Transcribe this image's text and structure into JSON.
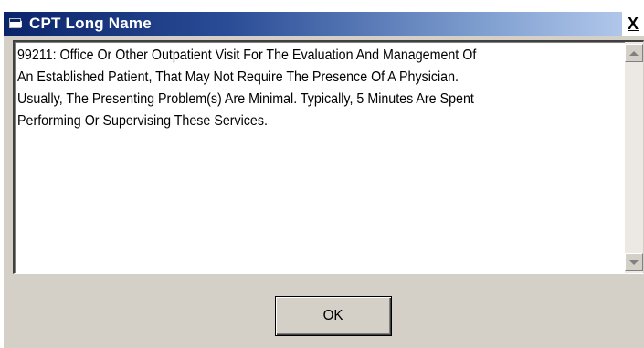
{
  "window": {
    "title": "CPT Long Name",
    "close_label": "X"
  },
  "textbox": {
    "value": "99211: Office Or Other Outpatient Visit For The Evaluation And Management Of\nAn Established Patient, That May Not Require The Presence Of A Physician.\nUsually, The Presenting Problem(s) Are Minimal. Typically, 5 Minutes Are Spent\nPerforming Or Supervising These Services."
  },
  "buttons": {
    "ok_label": "OK"
  },
  "icons": {
    "app": "window-app-icon",
    "close": "close-icon",
    "scroll_up": "scroll-up-arrow-icon",
    "scroll_down": "scroll-down-arrow-icon"
  },
  "colors": {
    "titlebar_start": "#0a246a",
    "titlebar_end": "#b8cdee",
    "dialog_face": "#d4d0c8"
  }
}
